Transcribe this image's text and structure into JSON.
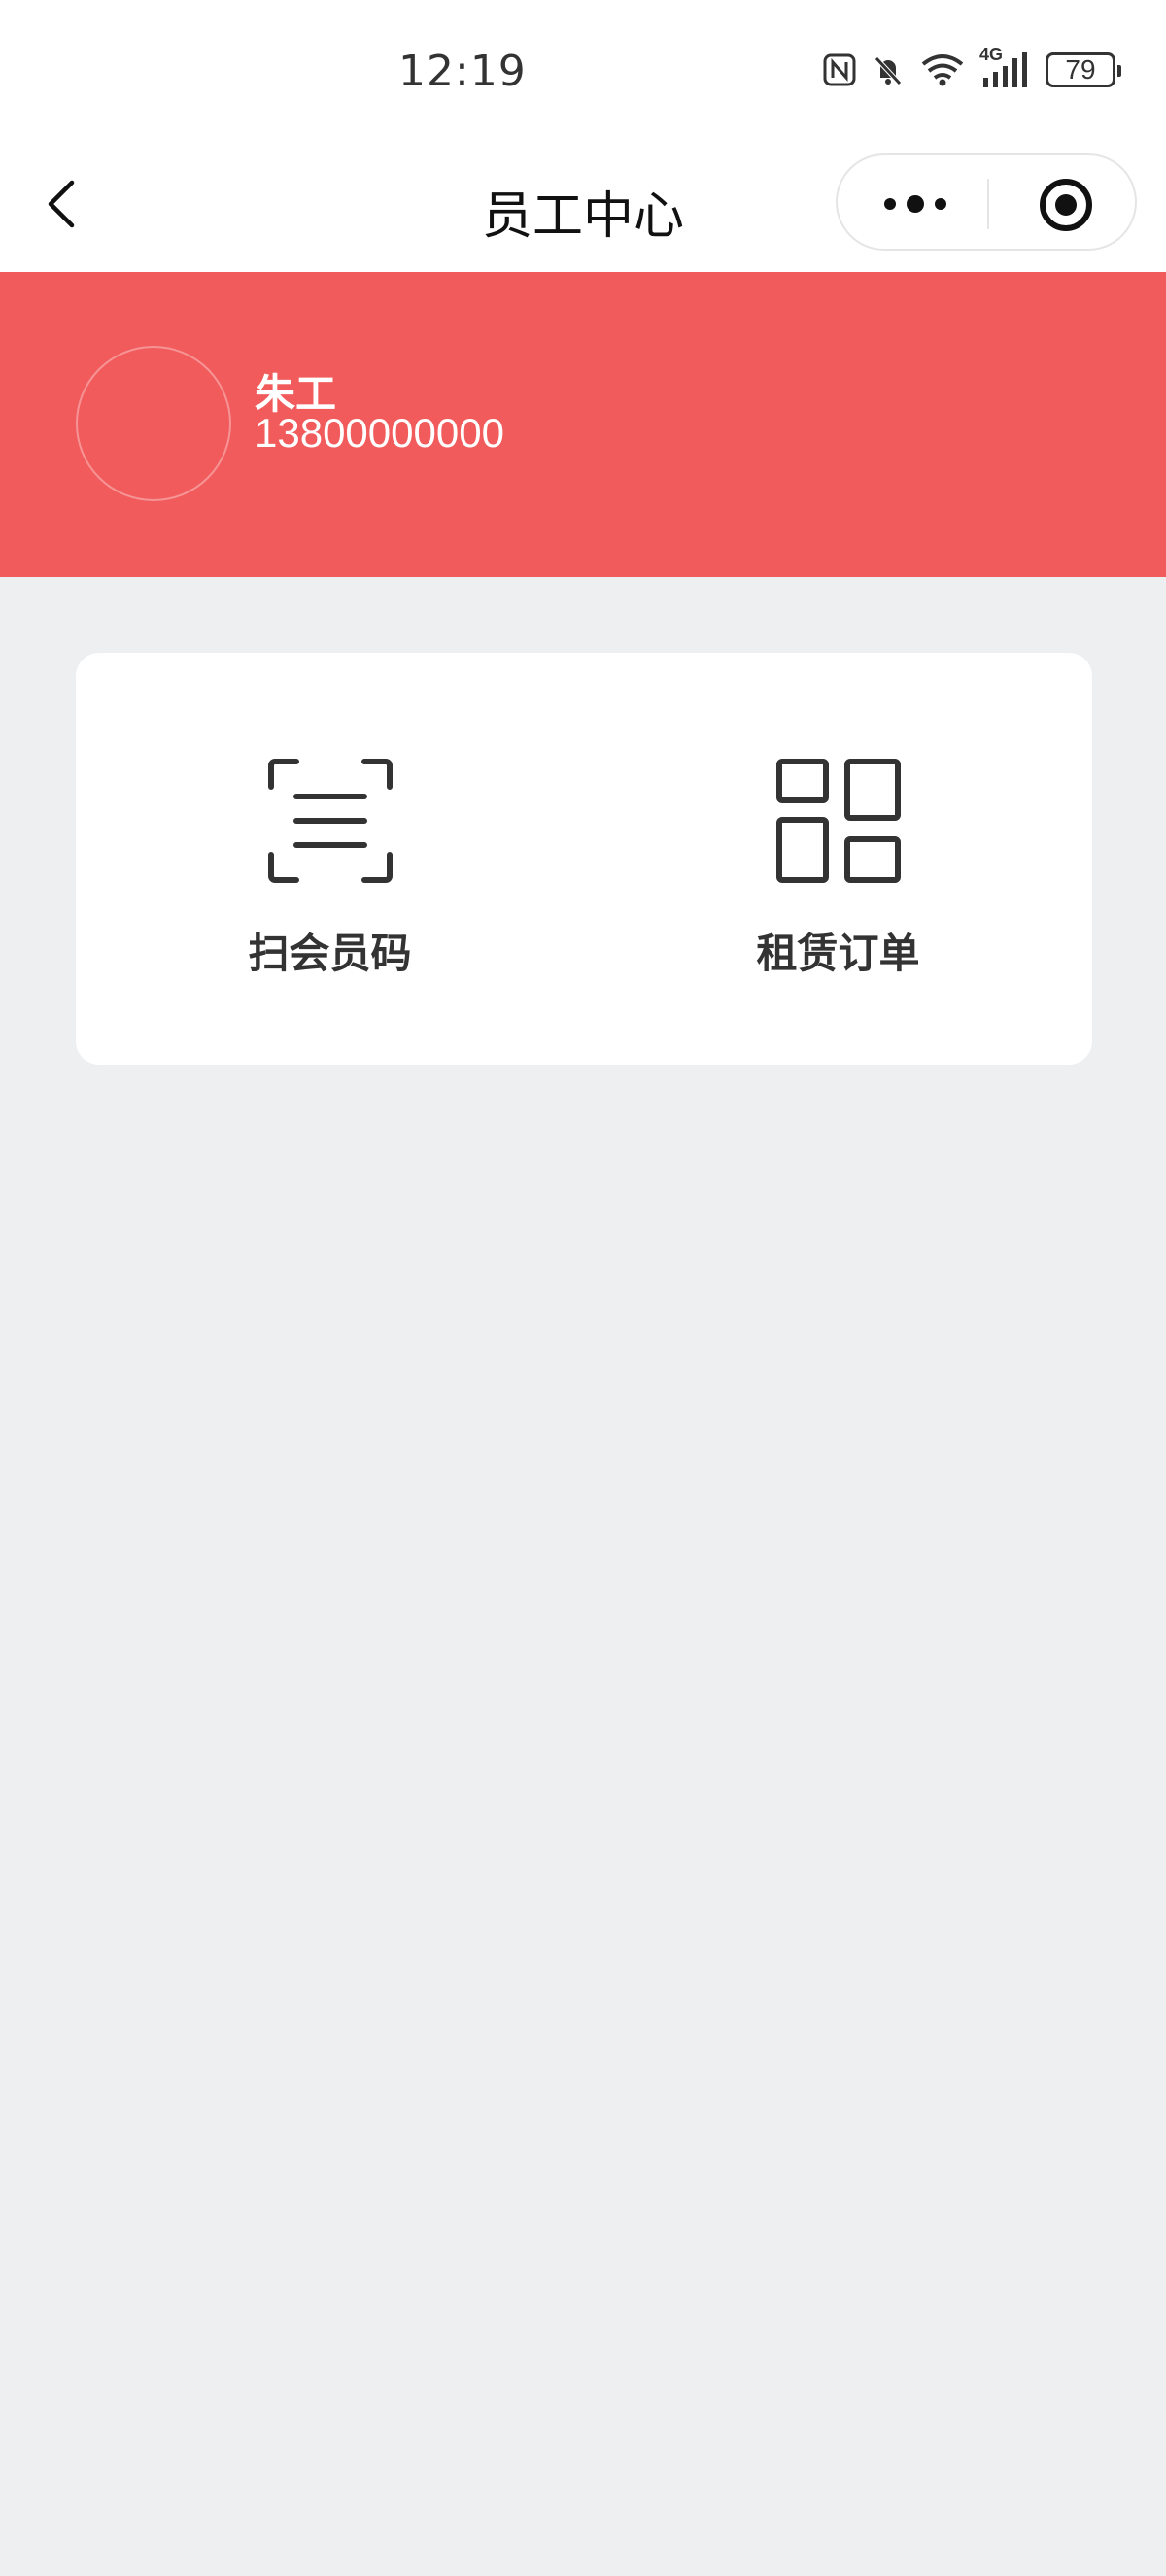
{
  "status_bar": {
    "time": "12:19",
    "battery": "79",
    "network": "4G",
    "icons": [
      "nfc-icon",
      "mute-icon",
      "wifi-icon",
      "signal-icon",
      "battery-icon"
    ]
  },
  "nav": {
    "title": "员工中心",
    "icons": [
      "back-icon",
      "more-icon",
      "close-miniprogram-icon"
    ]
  },
  "profile": {
    "name": "朱工",
    "phone": "13800000000"
  },
  "menu": {
    "items": [
      {
        "label": "扫会员码",
        "icon": "scan-icon"
      },
      {
        "label": "租赁订单",
        "icon": "grid-icon"
      }
    ]
  },
  "colors": {
    "header_bg": "#f25b5c",
    "page_bg": "#eeeff1",
    "card_bg": "#ffffff",
    "text_dark": "#333333"
  }
}
